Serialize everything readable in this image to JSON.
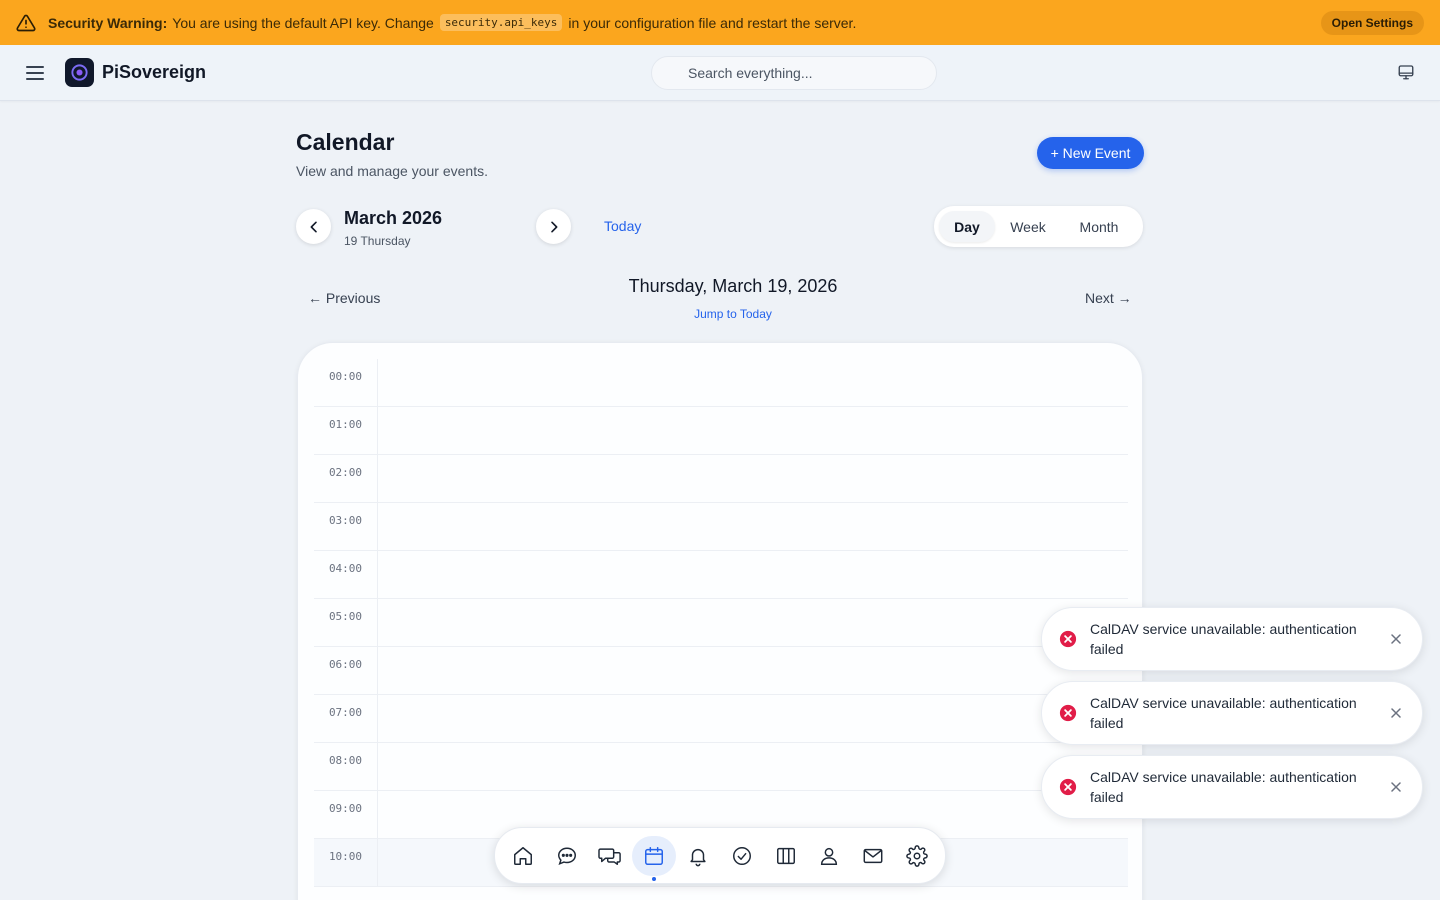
{
  "banner": {
    "title": "Security Warning:",
    "text_before": "You are using the default API key. Change",
    "code": "security.api_keys",
    "text_after": "in your configuration file and restart the server.",
    "button": "Open Settings",
    "bg_color": "#fba61e"
  },
  "header": {
    "brand": "PiSovereign",
    "search_placeholder": "Search everything..."
  },
  "page": {
    "title": "Calendar",
    "subtitle": "View and manage your events.",
    "new_event_label": "+ New Event"
  },
  "nav": {
    "month": "March 2026",
    "day": "19 Thursday",
    "today_label": "Today",
    "views": [
      "Day",
      "Week",
      "Month"
    ],
    "active_view": "Day"
  },
  "day_view": {
    "previous_label": "← Previous",
    "next_label": "Next →",
    "heading": "Thursday, March 19, 2026",
    "jump_label": "Jump to Today",
    "hours": [
      "00:00",
      "01:00",
      "02:00",
      "03:00",
      "04:00",
      "05:00",
      "06:00",
      "07:00",
      "08:00",
      "09:00",
      "10:00"
    ],
    "current_hour": "10:00"
  },
  "toasts": [
    {
      "message": "CalDAV service unavailable: authentication failed"
    },
    {
      "message": "CalDAV service unavailable: authentication failed"
    },
    {
      "message": "CalDAV service unavailable: authentication failed"
    }
  ],
  "dock": {
    "items": [
      "home-icon",
      "chat-icon",
      "conversations-icon",
      "calendar-icon",
      "bell-icon",
      "check-circle-icon",
      "columns-icon",
      "user-icon",
      "mail-icon",
      "gear-icon"
    ],
    "active": "calendar-icon",
    "accent_color": "#2563eb"
  }
}
